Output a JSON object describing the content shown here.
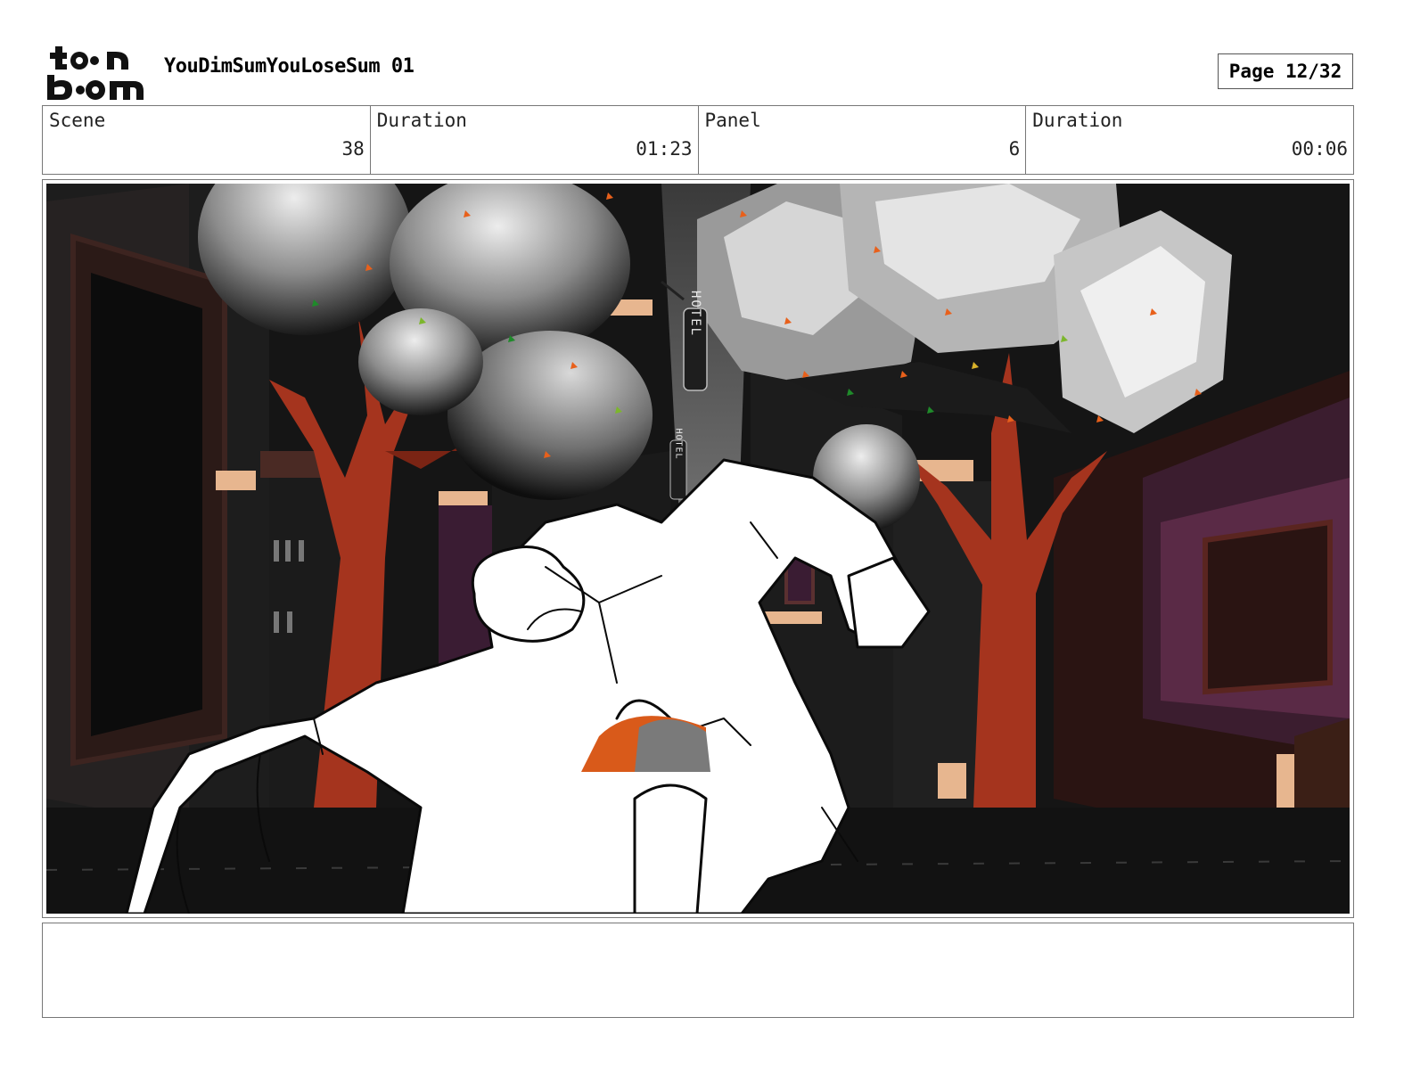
{
  "header": {
    "logo_alt": "toon boom",
    "project_title": "YouDimSumYouLoseSum 01",
    "page_label": "Page 12/32"
  },
  "info": {
    "scene_label": "Scene",
    "scene_value": "38",
    "scene_duration_label": "Duration",
    "scene_duration_value": "01:23",
    "panel_label": "Panel",
    "panel_value": "6",
    "panel_duration_label": "Duration",
    "panel_duration_value": "00:06"
  },
  "panel": {
    "sign_text_1": "HOTEL",
    "sign_text_2": "HOTEL"
  },
  "notes": {
    "text": ""
  }
}
